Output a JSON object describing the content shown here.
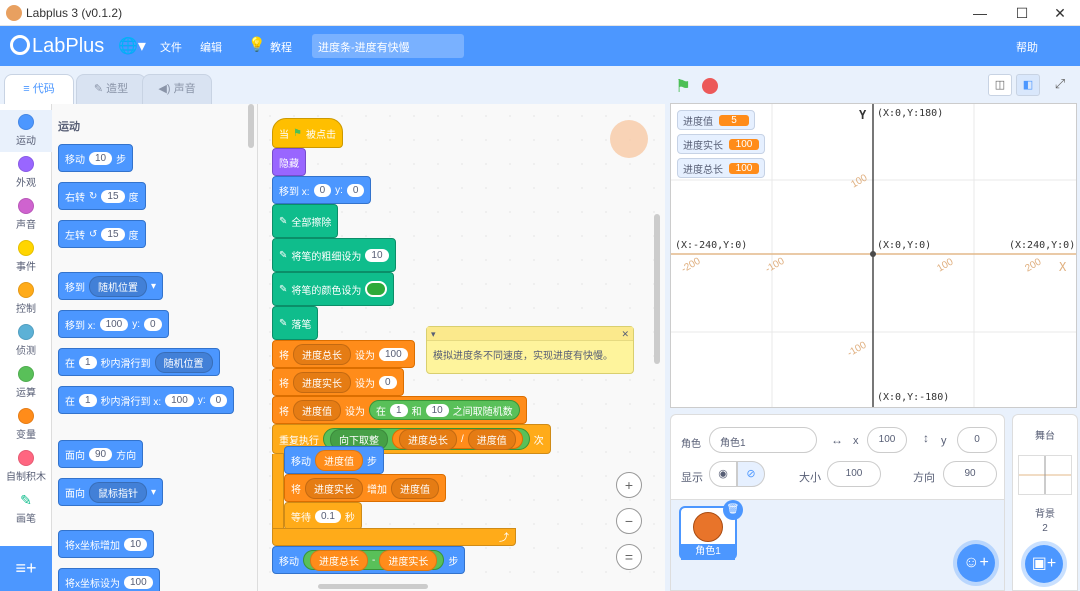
{
  "window": {
    "title": "Labplus 3 (v0.1.2)"
  },
  "menubar": {
    "logo": "LabPlus",
    "file": "文件",
    "edit": "编辑",
    "tutorial": "教程",
    "project_title": "进度条-进度有快慢",
    "help": "帮助"
  },
  "tabs": {
    "code": "代码",
    "costumes": "造型",
    "sounds": "声音"
  },
  "categories": [
    {
      "label": "运动",
      "color": "#4c97ff"
    },
    {
      "label": "外观",
      "color": "#9966ff"
    },
    {
      "label": "声音",
      "color": "#cf63cf"
    },
    {
      "label": "事件",
      "color": "#ffd500"
    },
    {
      "label": "控制",
      "color": "#ffab19"
    },
    {
      "label": "侦测",
      "color": "#5cb1d6"
    },
    {
      "label": "运算",
      "color": "#59c059"
    },
    {
      "label": "变量",
      "color": "#ff8c1a"
    },
    {
      "label": "自制积木",
      "color": "#ff6680"
    },
    {
      "label": "画笔",
      "color": "#0fbd8c"
    }
  ],
  "flyout": {
    "heading": "运动",
    "move": "移动",
    "move_val": "10",
    "steps": "步",
    "turn_right": "右转",
    "turn_right_val": "15",
    "deg": "度",
    "turn_left": "左转",
    "turn_left_val": "15",
    "goto": "移到",
    "goto_dd": "随机位置",
    "goto_xy": "移到 x:",
    "goto_x": "100",
    "y_label": "y:",
    "goto_y": "0",
    "in": "在",
    "glide_secs": "1",
    "glide_to": "秒内滑行到",
    "glide_dd": "随机位置",
    "glide_xy": "秒内滑行到 x:",
    "glide_x": "100",
    "glide_y": "0",
    "point_dir": "面向",
    "point_val": "90",
    "direction": "方向",
    "point_towards": "面向",
    "point_towards_dd": "鼠标指针",
    "change_x": "将x坐标增加",
    "change_x_val": "10",
    "set_x": "将x坐标设为",
    "set_x_val": "100"
  },
  "script": {
    "when": "当",
    "clicked": "被点击",
    "hide": "隐藏",
    "goto_xy": "移到 x:",
    "x": "0",
    "y_label": "y:",
    "y": "0",
    "clear": "全部擦除",
    "set_pen_size": "将笔的粗细设为",
    "pen_size": "10",
    "set_pen_color": "将笔的颜色设为",
    "pen_down": "落笔",
    "set": "将",
    "to": "设为",
    "var_total": "进度总长",
    "var_real": "进度实长",
    "var_value": "进度值",
    "total_val": "100",
    "real_val": "0",
    "pick_random_in": "在",
    "rand_from": "1",
    "and": "和",
    "rand_to": "10",
    "between": "之间取随机数",
    "repeat": "重复执行",
    "round_down": "向下取整",
    "div": "/",
    "times": "次",
    "move": "移动",
    "steps": "步",
    "change": "增加",
    "wait": "等待",
    "wait_val": "0.1",
    "secs": "秒",
    "minus": "-",
    "comment": "模拟进度条不同速度，实现进度有快慢。"
  },
  "stage": {
    "monitors": [
      {
        "label": "进度值",
        "value": "5"
      },
      {
        "label": "进度实长",
        "value": "100"
      },
      {
        "label": "进度总长",
        "value": "100"
      }
    ],
    "y_axis": "Y",
    "x_axis": "X",
    "top": "(X:0,Y:180)",
    "left": "(X:-240,Y:0)",
    "center": "(X:0,Y:0)",
    "right": "(X:240,Y:0)",
    "bottom": "(X:0,Y:-180)",
    "grid_labels": [
      "100",
      "-200",
      "-100",
      "100",
      "200",
      "-100"
    ]
  },
  "sprite_info": {
    "sprite_label": "角色",
    "sprite_name": "角色1",
    "x_label": "x",
    "x": "100",
    "y_label": "y",
    "y": "0",
    "show_label": "显示",
    "size_label": "大小",
    "size": "100",
    "direction_label": "方向",
    "direction": "90"
  },
  "sprite_list": [
    {
      "name": "角色1"
    }
  ],
  "stage_panel": {
    "title": "舞台",
    "backdrop_label": "背景",
    "backdrop_count": "2"
  }
}
